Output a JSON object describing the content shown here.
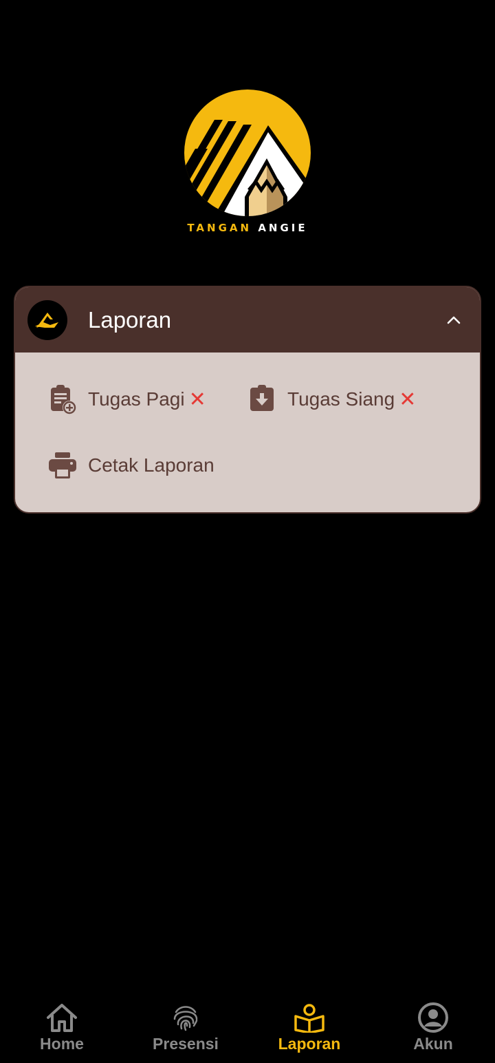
{
  "logo": {
    "text_left": "TANGAN",
    "text_right": "ANGIE"
  },
  "card": {
    "title": "Laporan",
    "items": [
      {
        "label": "Tugas Pagi",
        "status": "✕"
      },
      {
        "label": "Tugas Siang",
        "status": "✕"
      },
      {
        "label": "Cetak Laporan"
      }
    ]
  },
  "nav": {
    "items": [
      {
        "label": "Home",
        "icon": "home-icon"
      },
      {
        "label": "Presensi",
        "icon": "fingerprint-icon"
      },
      {
        "label": "Laporan",
        "icon": "book-icon",
        "active": true
      },
      {
        "label": "Akun",
        "icon": "account-icon"
      }
    ]
  },
  "colors": {
    "accent": "#f5b90f",
    "header": "#4a302b",
    "card_body": "#d8ccc8",
    "text": "#5a3c36",
    "error": "#e53935",
    "inactive": "#8a8a8a"
  }
}
